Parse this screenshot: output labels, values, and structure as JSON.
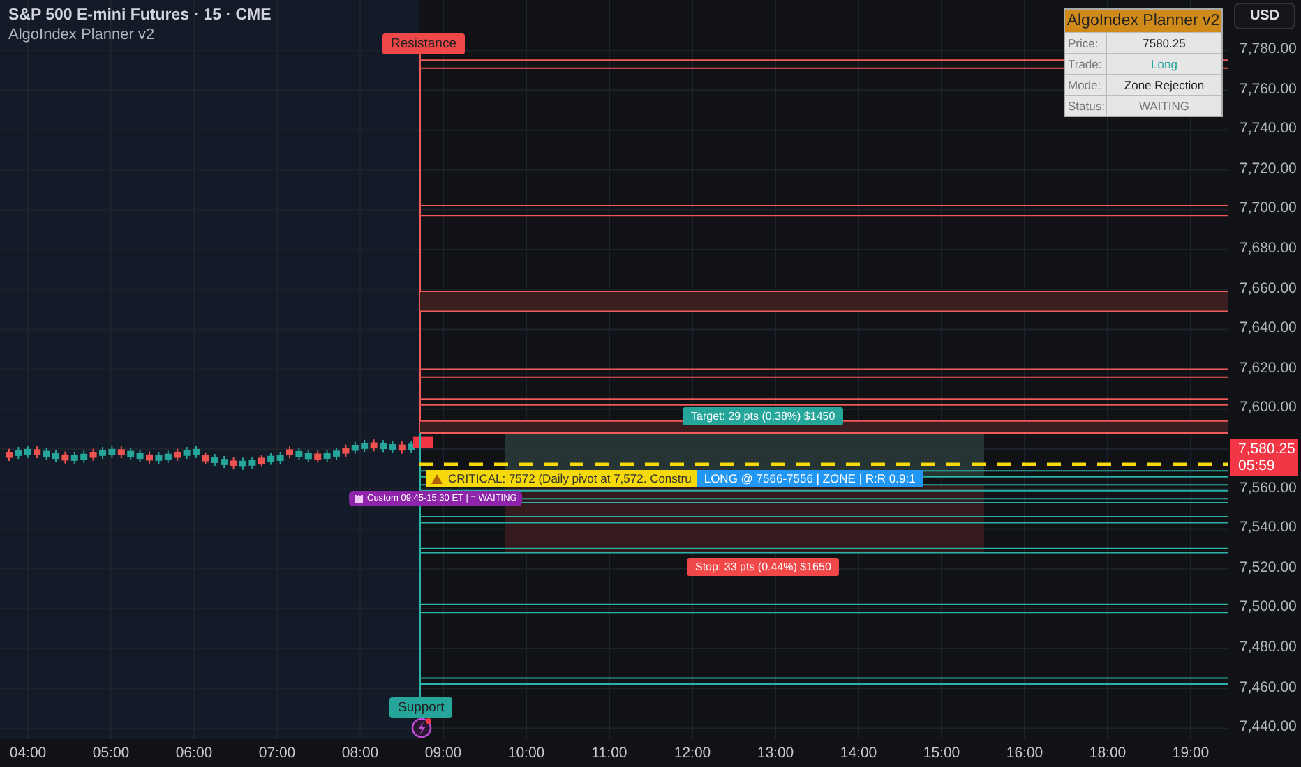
{
  "header": {
    "symbol": "S&P 500 E-mini Futures · 15 · CME",
    "indicator": "AlgoIndex Planner v2"
  },
  "currency_button": "USD",
  "info_panel": {
    "title": "AlgoIndex Planner v2",
    "rows": [
      {
        "label": "Price:",
        "value": "7580.25",
        "kind": "plain"
      },
      {
        "label": "Trade:",
        "value": "Long",
        "kind": "long"
      },
      {
        "label": "Mode:",
        "value": "Zone Rejection",
        "kind": "plain"
      },
      {
        "label": "Status:",
        "value": "WAITING",
        "kind": "muted"
      }
    ]
  },
  "price_axis": [
    "7,780.00",
    "7,760.00",
    "7,740.00",
    "7,720.00",
    "7,700.00",
    "7,680.00",
    "7,660.00",
    "7,640.00",
    "7,620.00",
    "7,600.00",
    "7,560.00",
    "7,540.00",
    "7,520.00",
    "7,500.00",
    "7,480.00",
    "7,460.00",
    "7,440.00"
  ],
  "current_price": {
    "price": "7,580.25",
    "countdown": "05:59"
  },
  "time_axis": [
    "04:00",
    "05:00",
    "06:00",
    "07:00",
    "08:00",
    "09:00",
    "10:00",
    "11:00",
    "12:00",
    "13:00",
    "14:00",
    "15:00",
    "16:00",
    "18:00",
    "19:00"
  ],
  "chart_labels": {
    "resistance": "Resistance",
    "support": "Support",
    "target": "Target: 29 pts (0.38%) $1450",
    "stop": "Stop: 33 pts (0.44%) $1650",
    "critical": "CRITICAL: 7572 (Daily pivot at 7,572. Constru",
    "entry": "LONG @ 7566-7556 | ZONE | R:R 0.9:1",
    "session": "Custom 09:45-15:30 ET | = WAITING"
  }
}
